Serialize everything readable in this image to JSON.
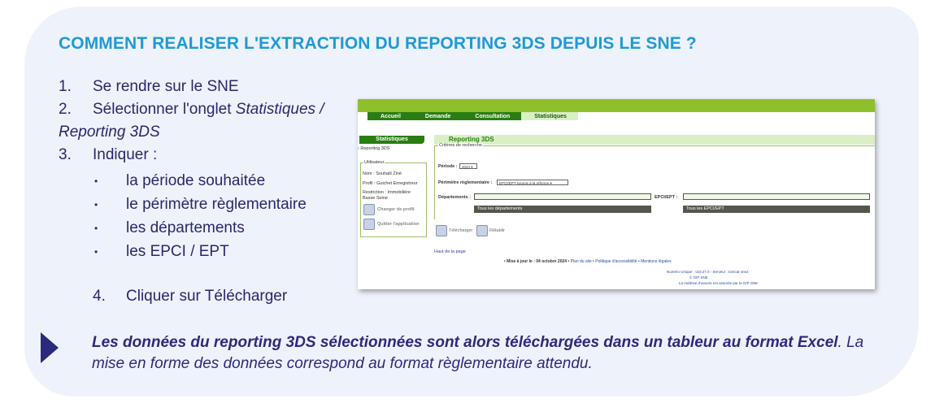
{
  "title": "COMMENT REALISER L'EXTRACTION DU REPORTING 3DS DEPUIS LE SNE ?",
  "steps": {
    "s1_num": "1.",
    "s1_text": "Se rendre sur le SNE",
    "s2_num": "2.",
    "s2_text": "Sélectionner l'onglet ",
    "s2_em1": "Statistiques /",
    "s2_em2": "Reporting 3DS",
    "s3_num": "3.",
    "s3_text": "Indiquer :",
    "bullet_glyph": "•",
    "bullets": [
      "la période souhaitée",
      "le périmètre règlementaire",
      "les départements",
      "les EPCI / EPT"
    ],
    "s4_num": "4.",
    "s4_text": "Cliquer sur Télécharger"
  },
  "conclusion": {
    "bold": "Les données du reporting 3DS sélectionnées sont alors téléchargées dans un tableur au format Excel",
    "rest": ". La mise en forme des données correspond au format règlementaire attendu."
  },
  "screenshot": {
    "nav": [
      "Accueil",
      "Demande",
      "Consultation",
      "Statistiques"
    ],
    "left_head": "Statistiques",
    "left_link": "› Reporting 3DS",
    "user_label": "Utilisateur",
    "user_name": "Nom : Souhaili Ziné",
    "user_profile": "Profil : Guichet Enregistreur",
    "user_restriction": "Restriction : Immobilière",
    "user_region": "Basse Seine",
    "change_profile": "Changer de profil",
    "quit_app": "Quitter l'application",
    "main_head": "Reporting 3DS",
    "crit_label": "Critères de recherche",
    "periode_label": "Période :",
    "periode_value": "2024 ▾",
    "perimetre_label": "Périmètre règlementaire :",
    "perimetre_value": "EPCI/EPT soumis à la réforme ▾",
    "departements_label": "Départements :",
    "epci_label": "EPCI/EPT :",
    "all_dept_button": "Tous les départements",
    "all_epci_button": "Tous les EPCI/EPT",
    "download_label": "Télécharger",
    "reset_label": "Rétablir",
    "top_link": "Haut de la page",
    "footer_update": "• Mise à jour le : 04 octobre 2024 •",
    "footer_links": [
      "Plan du site",
      "Politique d'accessibilité",
      "Mentions légales"
    ],
    "footer_sep": "•",
    "footer_version": "Numéro Unique : v10.27.0 - Serveur : tomcat sne2",
    "footer_copyright": "© GIP SNE",
    "footer_maitrise": "La maîtrise d'oeuvre est assurée par le GIP SNE"
  }
}
